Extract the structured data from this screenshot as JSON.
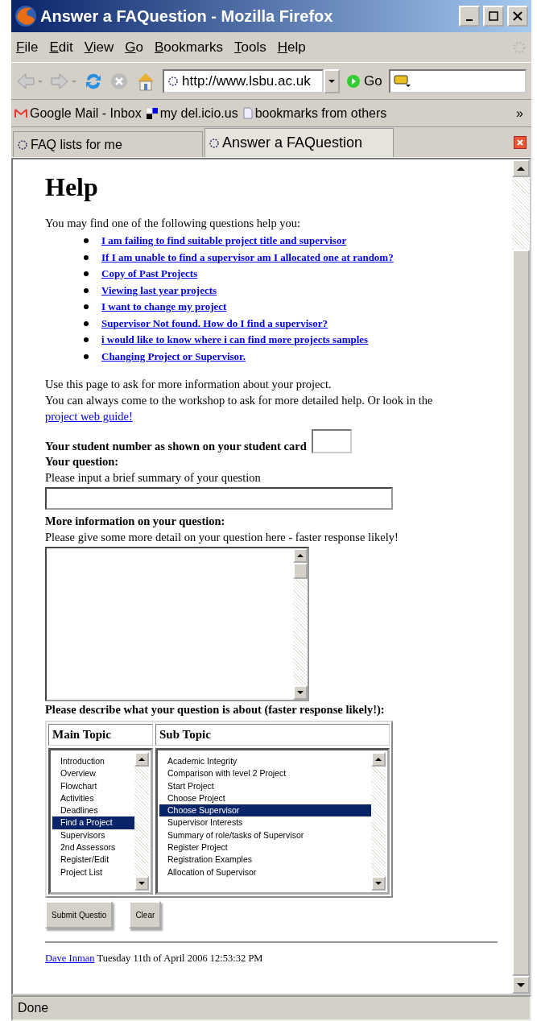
{
  "window": {
    "title": "Answer a FAQuestion - Mozilla Firefox"
  },
  "menu": [
    "File",
    "Edit",
    "View",
    "Go",
    "Bookmarks",
    "Tools",
    "Help"
  ],
  "toolbar": {
    "url": "http://www.lsbu.ac.uk",
    "go": "Go"
  },
  "bookmarks": [
    "Google Mail - Inbox",
    "my del.icio.us",
    "bookmarks from others"
  ],
  "bookmarks_more": "»",
  "tabs": [
    {
      "label": "FAQ lists for me",
      "selected": false
    },
    {
      "label": "Answer a FAQuestion",
      "selected": true
    }
  ],
  "page": {
    "heading": "Help",
    "intro": "You may find one of the following questions help you:",
    "faq_links": [
      "I am failing to find suitable project title and supervisor",
      "If I am unable to find a supervisor am I allocated one at random?",
      "Copy of Past Projects",
      "Viewing last year projects",
      "I want to change my project",
      "Supervisor Not found. How do I find a supervisor?",
      "i would like to know where i can find more projects samples",
      "Changing Project or Supervisor."
    ],
    "info": [
      "Use this page to ask for more information about your project.",
      "You can always come to the workshop to ask for more detailed help. Or look in the"
    ],
    "guide_link": "project web guide!",
    "student_number_label": "Your student number as shown on your student card",
    "question_label": "Your question:",
    "question_hint": "Please input a brief summary of your question",
    "more_label": "More information on your question:",
    "more_hint": "Please give some more detail on your question here - faster response likely!",
    "topic_prompt": "Please describe what your question is about (faster response likely!):",
    "main_topic": {
      "heading": "Main Topic",
      "items": [
        {
          "label": "Introduction",
          "selected": false
        },
        {
          "label": "Overview",
          "selected": false
        },
        {
          "label": "Flowchart",
          "selected": false
        },
        {
          "label": "Activities",
          "selected": false
        },
        {
          "label": "Deadlines",
          "selected": false
        },
        {
          "label": "Find a Project",
          "selected": true
        },
        {
          "label": "Supervisors",
          "selected": false
        },
        {
          "label": "2nd Assessors",
          "selected": false
        },
        {
          "label": "Register/Edit",
          "selected": false
        },
        {
          "label": "Project List",
          "selected": false
        }
      ]
    },
    "sub_topic": {
      "heading": "Sub Topic",
      "items": [
        {
          "label": "Academic Integrity",
          "selected": false
        },
        {
          "label": "Comparison with level 2 Project",
          "selected": false
        },
        {
          "label": "Start Project",
          "selected": false
        },
        {
          "label": "Choose Project",
          "selected": false
        },
        {
          "label": "Choose Supervisor",
          "selected": true
        },
        {
          "label": "Supervisor Interests",
          "selected": false
        },
        {
          "label": "Summary of role/tasks of Supervisor",
          "selected": false
        },
        {
          "label": "Register Project",
          "selected": false
        },
        {
          "label": "Registration Examples",
          "selected": false
        },
        {
          "label": "Allocation of Supervisor",
          "selected": false
        }
      ]
    },
    "buttons": [
      "Submit Questio",
      "Clear"
    ],
    "footer": {
      "author": "Dave Inman",
      "date": "Tuesday 11th of April 2006 12:53:32 PM"
    }
  },
  "status_bar": "Done"
}
